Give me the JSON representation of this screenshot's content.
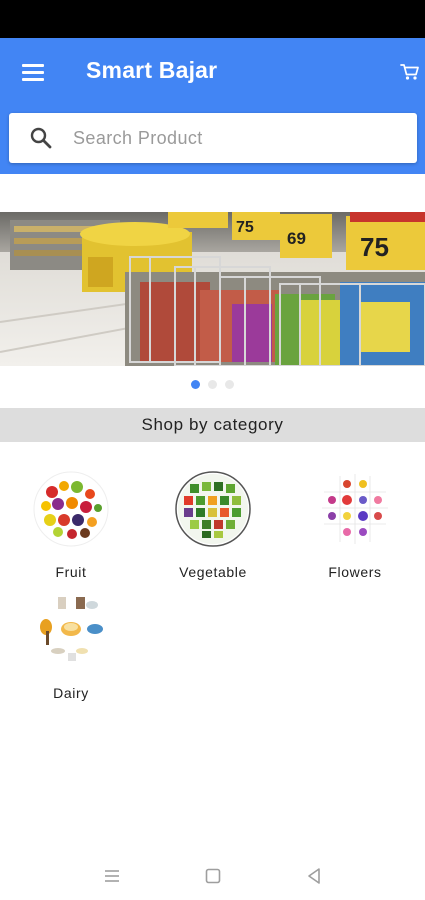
{
  "app": {
    "title": "Smart Bajar",
    "brand_color": "#4285f4"
  },
  "header": {
    "menu_icon": "hamburger-menu-icon",
    "cart_icon": "shopping-cart-icon"
  },
  "search": {
    "placeholder": "Search Product",
    "value": "",
    "icon": "search-icon"
  },
  "banner": {
    "image": "supermarket-aisle-photo",
    "price_tags": [
      "75",
      "69",
      "75"
    ]
  },
  "carousel": {
    "active_index": 0,
    "slide_count": 3
  },
  "section": {
    "title": "Shop by category"
  },
  "categories": [
    {
      "label": "Fruit",
      "icon": "fruit-collage-icon"
    },
    {
      "label": "Vegetable",
      "icon": "vegetable-collage-icon"
    },
    {
      "label": "Flowers",
      "icon": "flower-chart-icon"
    },
    {
      "label": "Dairy",
      "icon": "dairy-products-icon"
    }
  ],
  "system_nav": {
    "recents_icon": "recents-icon",
    "home_icon": "home-icon",
    "back_icon": "back-icon"
  }
}
